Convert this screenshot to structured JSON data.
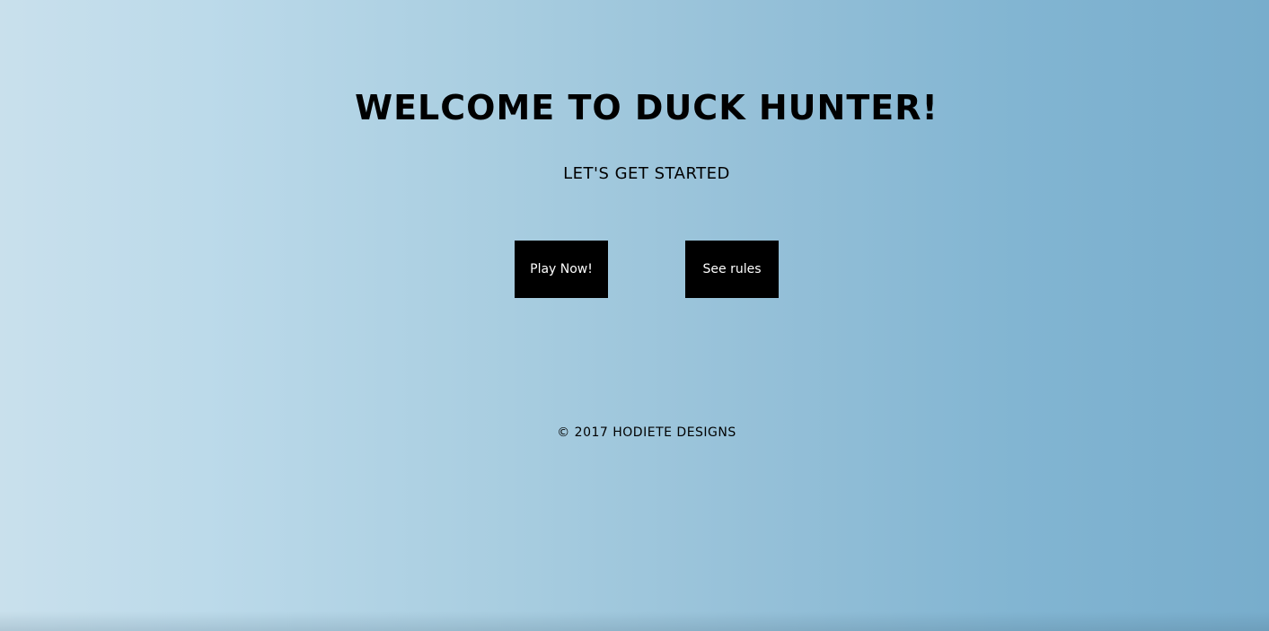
{
  "header": {
    "title": "WELCOME TO DUCK HUNTER!",
    "subtitle": "LET'S GET STARTED"
  },
  "actions": {
    "play_label": "Play Now!",
    "rules_label": "See rules"
  },
  "footer": {
    "copyright": "© 2017 HODIETE DESIGNS"
  },
  "colors": {
    "button_bg": "#000000",
    "button_text": "#ffffff",
    "gradient_left": "#c9e0ec",
    "gradient_right": "#78adcc"
  }
}
